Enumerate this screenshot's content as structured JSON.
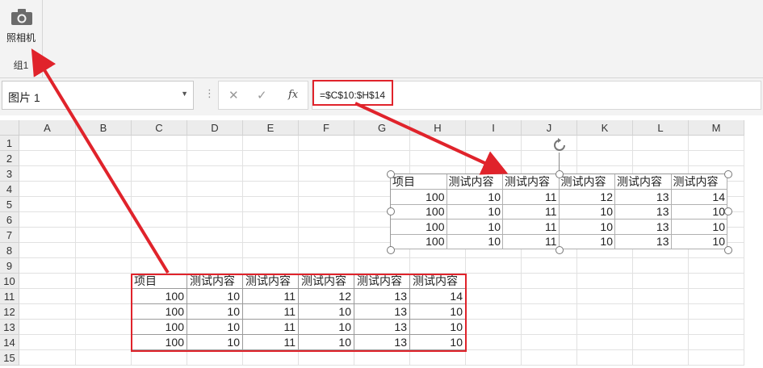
{
  "ribbon": {
    "camera_label": "照相机",
    "group_label": "组1"
  },
  "formula_bar": {
    "name_box": "图片 1",
    "formula": "=$C$10:$H$14",
    "fx_label": "fx"
  },
  "columns": [
    "A",
    "B",
    "C",
    "D",
    "E",
    "F",
    "G",
    "H",
    "I",
    "J",
    "K",
    "L",
    "M"
  ],
  "rows": [
    "1",
    "2",
    "3",
    "4",
    "5",
    "6",
    "7",
    "8",
    "9",
    "10",
    "11",
    "12",
    "13",
    "14",
    "15"
  ],
  "table": {
    "headers": [
      "项目",
      "测试内容",
      "测试内容",
      "测试内容",
      "测试内容",
      "测试内容"
    ],
    "rows": [
      [
        "100",
        "10",
        "11",
        "12",
        "13",
        "14"
      ],
      [
        "100",
        "10",
        "11",
        "10",
        "13",
        "10"
      ],
      [
        "100",
        "10",
        "11",
        "10",
        "13",
        "10"
      ],
      [
        "100",
        "10",
        "11",
        "10",
        "13",
        "10"
      ]
    ]
  },
  "colors": {
    "annotation_red": "#e0232b"
  }
}
